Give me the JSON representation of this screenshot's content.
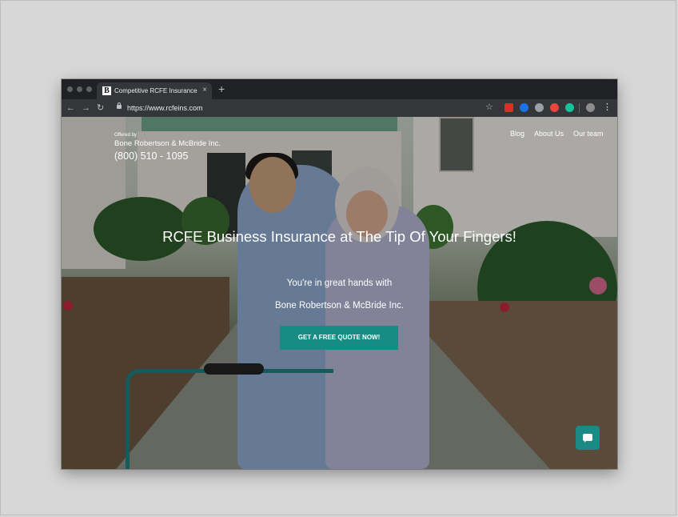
{
  "browser": {
    "tab": {
      "favicon_letter": "B",
      "title": "Competitive RCFE Insurance p",
      "close_glyph": "×"
    },
    "new_tab_glyph": "+",
    "nav": {
      "back": "←",
      "forward": "→",
      "reload": "↻"
    },
    "url": "https://www.rcfeins.com",
    "star": "☆",
    "menu": "⋮",
    "extensions": [
      {
        "icon": "extension-red-icon",
        "color": "#d93025"
      },
      {
        "icon": "extension-blue-icon",
        "color": "#1a73e8"
      },
      {
        "icon": "extension-gray-icon",
        "color": "#9aa0a6"
      },
      {
        "icon": "extension-drop-icon",
        "color": "#e8453c"
      },
      {
        "icon": "grammarly-icon",
        "color": "#15c39a"
      },
      {
        "icon": "profile-avatar-icon",
        "color": "#8d8d8d"
      }
    ]
  },
  "site": {
    "offered_by": "Offered by",
    "company": "Bone Robertson & McBride Inc.",
    "phone": "(800) 510 - 1095",
    "nav": [
      "Blog",
      "About Us",
      "Our team"
    ],
    "hero": {
      "title": "RCFE Business Insurance at The Tip Of Your Fingers!",
      "subtitle_line1": "You're in great hands with",
      "subtitle_line2": "Bone Robertson & McBride Inc.",
      "cta": "GET A FREE QUOTE NOW!"
    },
    "colors": {
      "accent": "#168c85"
    }
  }
}
